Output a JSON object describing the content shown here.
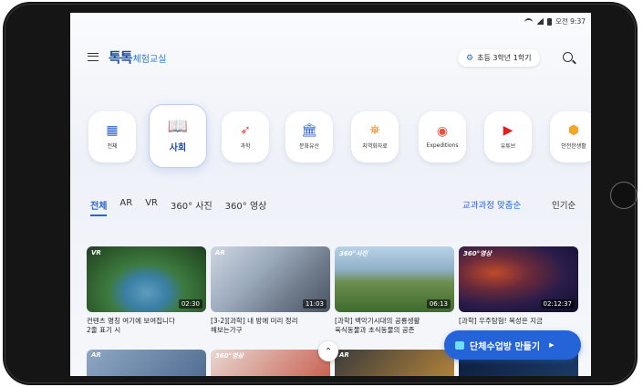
{
  "status_bar": {
    "time": "오전 9:37"
  },
  "header": {
    "logo_main": "톡톡",
    "logo_sub": "체험교실",
    "grade_label": "초등 3학년 1학기"
  },
  "categories": [
    {
      "label": "전체",
      "icon": "grid-icon",
      "color": "#2f63c9"
    },
    {
      "label": "사회",
      "icon": "book-icon",
      "color": "#1f4fa3"
    },
    {
      "label": "과학",
      "icon": "rocket-icon",
      "color": "#e2474c"
    },
    {
      "label": "문화유산",
      "icon": "museum-icon",
      "color": "#2f63c9"
    },
    {
      "label": "지역화자료",
      "icon": "map-person-icon",
      "color": "#f08a2a"
    },
    {
      "label": "Expeditions",
      "icon": "compass-icon",
      "color": "#e8503a"
    },
    {
      "label": "유튜브",
      "icon": "youtube-icon",
      "color": "#e02020"
    },
    {
      "label": "안전한생활",
      "icon": "location-icon",
      "color": "#f4a62a"
    }
  ],
  "tabs": [
    "전체",
    "AR",
    "VR",
    "360° 사진",
    "360° 영상"
  ],
  "sort": {
    "curriculum": "교과과정 맞춤순",
    "popular": "인기순"
  },
  "videos": [
    {
      "type": "VR",
      "duration": "02:30",
      "title_line1": "컨텐츠 명칭 여기에 보여집니다",
      "title_line2": "2줄 표기 시"
    },
    {
      "type": "AR",
      "duration": "11:03",
      "title_line1": "[3-2][과학] 내 방에 미리 정리",
      "title_line2": "해보는가구"
    },
    {
      "type": "360°사진",
      "duration": "06:13",
      "title_line1": "[과학] 백악기시대의 공룡생활",
      "title_line2": "육식동물과 초식동물의 공존"
    },
    {
      "type": "360°영상",
      "duration": "02:12:37",
      "title_line1": "[과학] 우주탐험! 목성은 지금",
      "title_line2": ""
    }
  ],
  "second_row": [
    {
      "type": "AR"
    },
    {
      "type": "360°영상"
    },
    {
      "type": "AR"
    },
    {
      "type": ""
    }
  ],
  "create_class_label": "단체수업방 만들기"
}
